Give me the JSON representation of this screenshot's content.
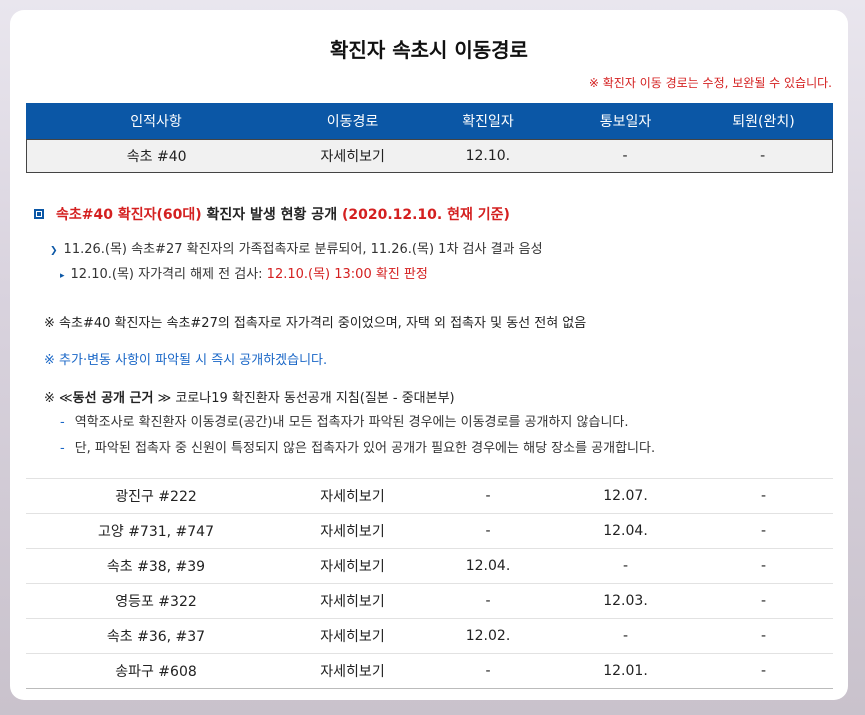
{
  "title": "확진자 속초시 이동경로",
  "notice": "※ 확진자 이동 경로는 수정, 보완될 수 있습니다.",
  "table": {
    "headers": [
      "인적사항",
      "이동경로",
      "확진일자",
      "통보일자",
      "퇴원(완치)"
    ],
    "highlight": [
      "속초 #40",
      "자세히보기",
      "12.10.",
      "-",
      "-"
    ]
  },
  "case": {
    "head_red": "속초#40 확진자(60대)",
    "head_black": " 확진자 발생 현황 공개 ",
    "head_date": "(2020.12.10. 현재 기준)",
    "line1": "11.26.(목) 속초#27 확진자의 가족접촉자로 분류되어, 11.26.(목) 1차 검사 결과 음성",
    "line2_prefix": "12.10.(목) 자가격리 해제 전 검사: ",
    "line2_red": "12.10.(목) 13:00 확진 판정"
  },
  "notes": {
    "note1": "※ 속초#40 확진자는 속초#27의 접촉자로 자가격리 중이었으며, 자택 외 접촉자 및 동선 전혀 없음",
    "note2": "※ 추가·변동 사항이 파악될 시 즉시 공개하겠습니다.",
    "note3_prefix": "※ ≪",
    "note3_bold": "동선 공개 근거",
    "note3_suffix": " ≫ 코로나19 확진환자 동선공개 지침(질본 - 중대본부)",
    "sub1": "역학조사로 확진환자 이동경로(공간)내 모든 접촉자가 파악된 경우에는 이동경로를 공개하지 않습니다.",
    "sub2": "단, 파악된 접촉자 중 신원이 특정되지 않은 접촉자가 있어 공개가 필요한 경우에는 해당 장소를 공개합니다."
  },
  "rows": [
    [
      "광진구 #222",
      "자세히보기",
      "-",
      "12.07.",
      "-"
    ],
    [
      "고양 #731, #747",
      "자세히보기",
      "-",
      "12.04.",
      "-"
    ],
    [
      "속초 #38, #39",
      "자세히보기",
      "12.04.",
      "-",
      "-"
    ],
    [
      "영등포 #322",
      "자세히보기",
      "-",
      "12.03.",
      "-"
    ],
    [
      "속초 #36, #37",
      "자세히보기",
      "12.02.",
      "-",
      "-"
    ],
    [
      "송파구 #608",
      "자세히보기",
      "-",
      "12.01.",
      "-"
    ]
  ]
}
